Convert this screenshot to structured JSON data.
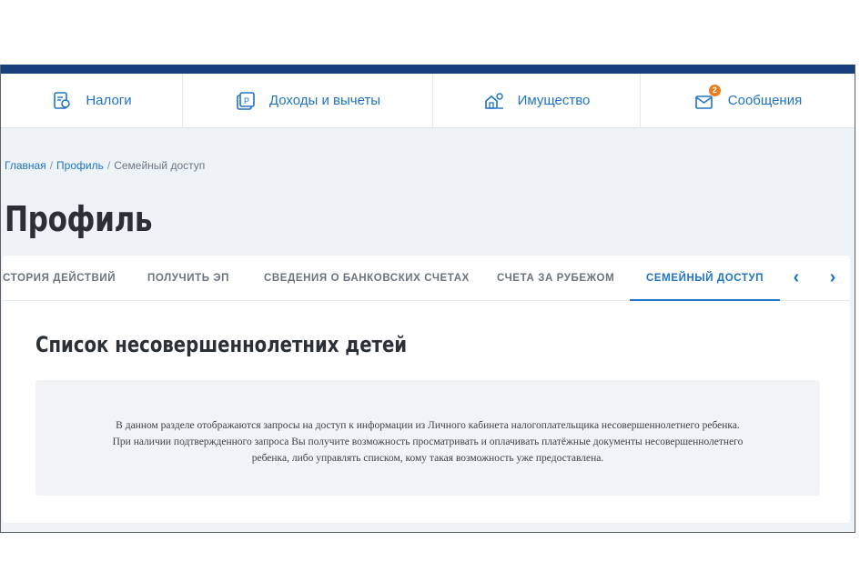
{
  "nav": {
    "items": [
      {
        "label": "Налоги",
        "icon": "tax-document-icon"
      },
      {
        "label": "Доходы и вычеты",
        "icon": "income-deduction-icon"
      },
      {
        "label": "Имущество",
        "icon": "property-icon"
      },
      {
        "label": "Сообщения",
        "icon": "envelope-icon",
        "badge": "2"
      }
    ]
  },
  "breadcrumb": {
    "home": "Главная",
    "separator": "/",
    "profile": "Профиль",
    "current": "Семейный доступ"
  },
  "page": {
    "title": "Профиль"
  },
  "tabs": {
    "items": [
      "стория действий",
      "получить ЭП",
      "сведения о банковских счетах",
      "счета за рубежом",
      "семейный доступ"
    ],
    "active_index": 4,
    "prev_icon": "chevron-left-icon",
    "next_icon": "chevron-right-icon"
  },
  "section": {
    "title": "Список несовершеннолетних детей",
    "info_lines": [
      "В данном разделе отображаются запросы на доступ к информации из Личного кабинета налогоплательщика несовершеннолетнего ребенка.",
      "При наличии подтвержденного запроса Вы получите возможность просматривать и оплачивать платёжные документы несовершеннолетнего",
      "ребенка, либо управлять списком, кому такая возможность уже предоставлена."
    ]
  },
  "colors": {
    "accent": "#1f73c6",
    "topbar": "#173f7c",
    "badge": "#f07b1d"
  }
}
